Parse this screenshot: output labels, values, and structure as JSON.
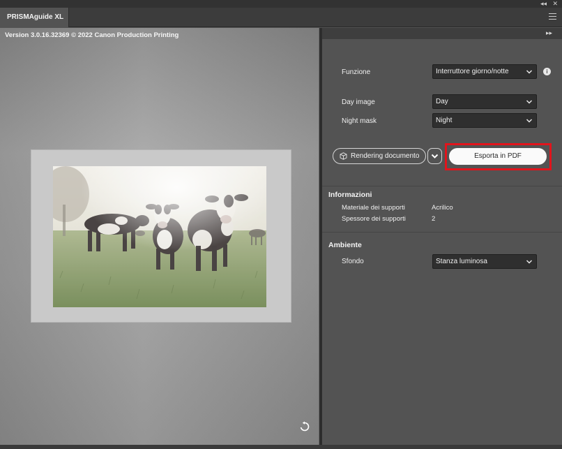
{
  "window": {
    "collapse_icon": "double-chevron-left",
    "close_icon": "close-x"
  },
  "tab": {
    "title": "PRISMAguide XL",
    "menu_icon": "hamburger-menu"
  },
  "preview": {
    "version_text": "Version 3.0.16.32369 © 2022 Canon Production Printing",
    "image_subject": "cows in a misty field",
    "refresh_icon": "refresh-rotate"
  },
  "panel": {
    "collapse_icon": "double-chevron-right",
    "function": {
      "label": "Funzione",
      "value": "Interruttore giorno/notte",
      "info_icon": "info-circle"
    },
    "day_image": {
      "label": "Day image",
      "value": "Day"
    },
    "night_mask": {
      "label": "Night mask",
      "value": "Night"
    },
    "render_button": {
      "label": "Rendering documento",
      "icon": "cube"
    },
    "export_button": {
      "label": "Esporta in PDF"
    },
    "info_section": {
      "title": "Informazioni",
      "rows": [
        {
          "key": "Materiale dei supporti",
          "value": "Acrilico"
        },
        {
          "key": "Spessore dei supporti",
          "value": "2"
        }
      ]
    },
    "environment_section": {
      "title": "Ambiente",
      "background": {
        "label": "Sfondo",
        "value": "Stanza luminosa"
      }
    }
  },
  "colors": {
    "panel_bg": "#535353",
    "highlight": "#e2141c",
    "export_bg": "#fafafa"
  }
}
